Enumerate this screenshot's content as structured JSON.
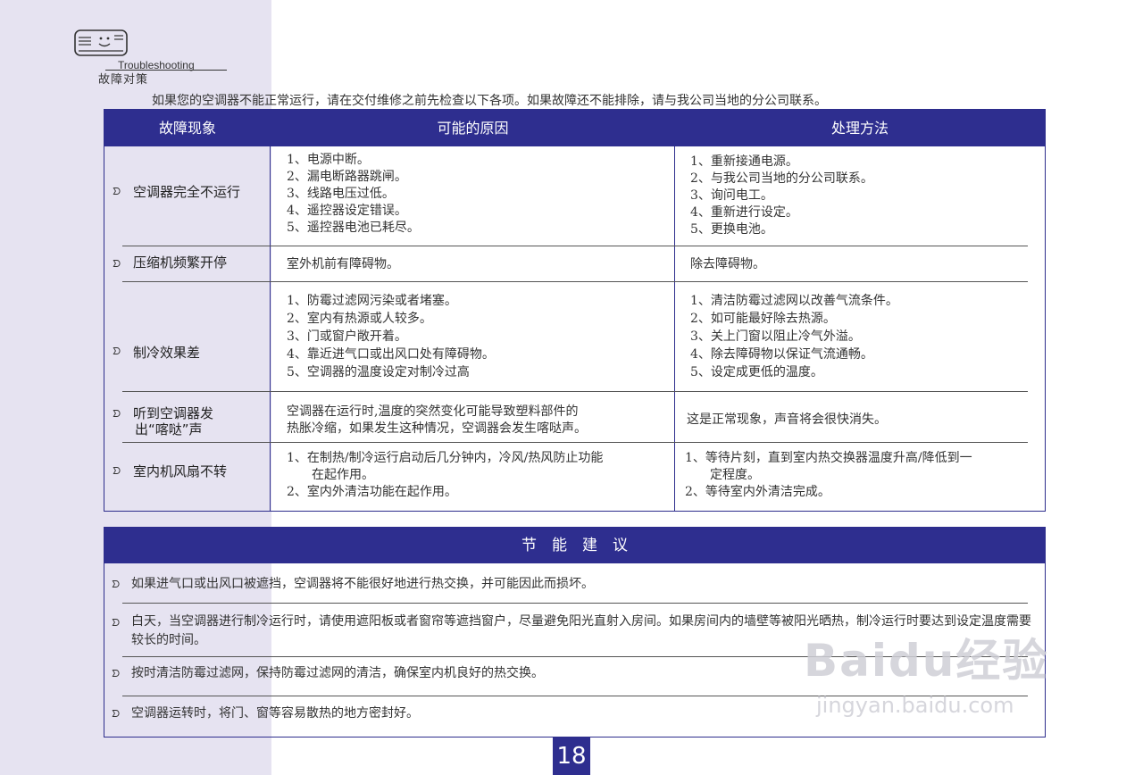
{
  "header": {
    "section_en": "Troubleshooting",
    "section_cn": "故障对策",
    "intro": "如果您的空调器不能正常运行，请在交付维修之前先检查以下各项。如果故障还不能排除，请与我公司当地的分公司联系。"
  },
  "troubleshooting_table": {
    "columns": [
      "故障现象",
      "可能的原因",
      "处理方法"
    ],
    "rows": [
      {
        "symptom": [
          "空调器完全不运行"
        ],
        "causes": [
          "1、电源中断。",
          "2、漏电断路器跳闸。",
          "3、线路电压过低。",
          "4、遥控器设定错误。",
          "5、遥控器电池已耗尽。"
        ],
        "solutions": [
          "1、重新接通电源。",
          "2、与我公司当地的分公司联系。",
          "3、询问电工。",
          "4、重新进行设定。",
          "5、更换电池。"
        ]
      },
      {
        "symptom": [
          "压缩机频繁开停"
        ],
        "causes": [
          "室外机前有障碍物。"
        ],
        "solutions": [
          "除去障碍物。"
        ]
      },
      {
        "symptom": [
          "制冷效果差"
        ],
        "causes": [
          "1、防霉过滤网污染或者堵塞。",
          "2、室内有热源或人较多。",
          "3、门或窗户敞开着。",
          "4、靠近进气口或出风口处有障碍物。",
          "5、空调器的温度设定对制冷过高"
        ],
        "solutions": [
          "1、清洁防霉过滤网以改善气流条件。",
          "2、如可能最好除去热源。",
          "3、关上门窗以阻止冷气外溢。",
          "4、除去障碍物以保证气流通畅。",
          "5、设定成更低的温度。"
        ]
      },
      {
        "symptom": [
          "听到空调器发",
          "出“喀哒”声"
        ],
        "causes": [
          "空调器在运行时,温度的突然变化可能导致塑料部件的",
          "热胀冷缩，如果发生这种情况，空调器会发生喀哒声。"
        ],
        "solutions": [
          "这是正常现象，声音将会很快消失。"
        ]
      },
      {
        "symptom": [
          "室内机风扇不转"
        ],
        "causes": [
          "1、在制热/制冷运行启动后几分钟内，冷风/热风防止功能",
          "　　在起作用。",
          "2、室内外清洁功能在起作用。"
        ],
        "solutions": [
          "1、等待片刻，直到室内热交换器温度升高/降低到一",
          "　　定程度。",
          "2、等待室内外清洁完成。"
        ]
      }
    ]
  },
  "energy_tips": {
    "title": "节　能　建　议",
    "items": [
      "如果进气口或出风口被遮挡，空调器将不能很好地进行热交换，并可能因此而损坏。",
      "白天，当空调器进行制冷运行时，请使用遮阳板或者窗帘等遮挡窗户，尽量避免阳光直射入房间。如果房间内的墙壁等被阳光晒热，制冷运行时要达到设定温度需要较长的时间。",
      "按时清洁防霉过滤网，保持防霉过滤网的清洁，确保室内机良好的热交换。",
      "空调器运转时，将门、窗等容易散热的地方密封好。"
    ]
  },
  "page_number": "18",
  "watermark": {
    "brand": "Baidu经验",
    "url": "jingyan.baidu.com"
  },
  "icons": {
    "bullet": "ᗤ",
    "logo": "air-conditioner-icon"
  },
  "colors": {
    "header_bg": "#2e2e8f",
    "left_band": "#e6e3f1",
    "border": "#2d2d8c"
  }
}
